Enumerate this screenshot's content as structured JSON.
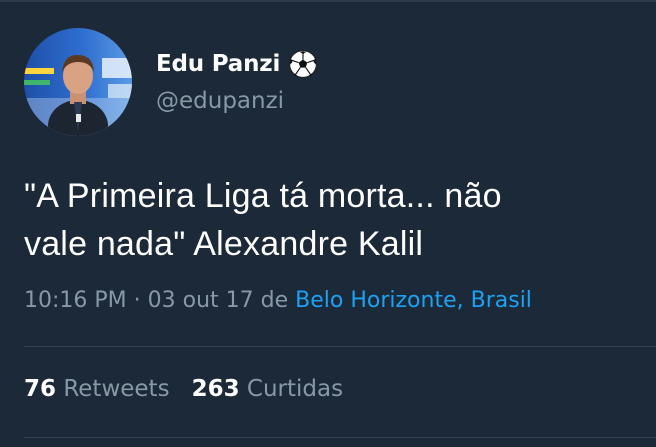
{
  "author": {
    "display_name": "Edu Panzi",
    "name_emoji": "soccer-ball",
    "handle": "@edupanzi"
  },
  "tweet": {
    "line1": "\"A Primeira Liga tá morta... não",
    "line2": "vale nada\" Alexandre Kalil",
    "time": "10:16 PM",
    "separator": " · ",
    "date": "03 out 17",
    "from_word": " de ",
    "location": "Belo Horizonte, Brasil"
  },
  "stats": {
    "retweets_count": "76",
    "retweets_label": " Retweets",
    "likes_count": "263",
    "likes_label": " Curtidas"
  },
  "colors": {
    "background": "#1c2938",
    "text": "#ffffff",
    "muted": "#8899a6",
    "link": "#1da1f2",
    "divider": "#38444d"
  }
}
